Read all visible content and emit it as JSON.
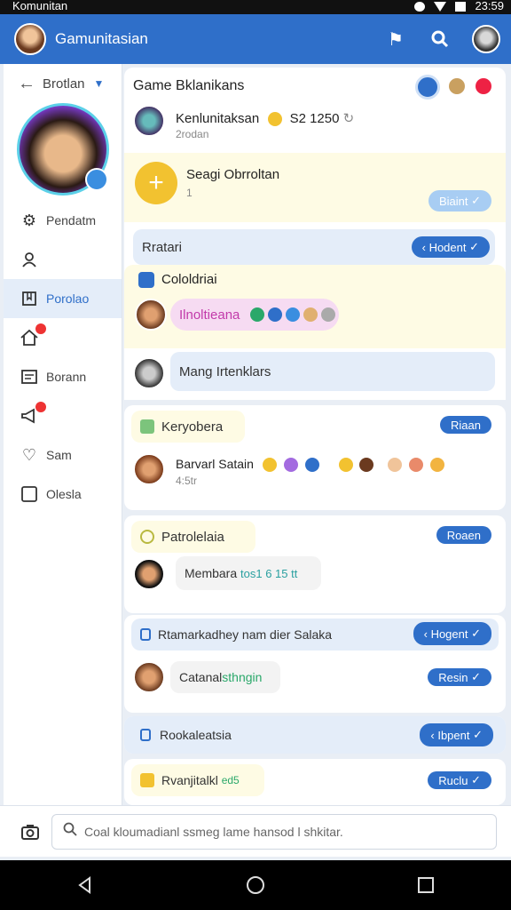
{
  "status": {
    "app_name": "Komunitan",
    "time": "23:59"
  },
  "appbar": {
    "title": "Gamunitasian"
  },
  "sidebar": {
    "back_label": "Brotlan",
    "items": [
      {
        "label": "Pendatm",
        "icon": "gear-icon"
      },
      {
        "label": "",
        "icon": "person-icon"
      },
      {
        "label": "Porolao",
        "icon": "bookmark-icon",
        "active": true
      },
      {
        "label": "",
        "icon": "home-icon",
        "badge": true
      },
      {
        "label": "Borann",
        "icon": "list-icon"
      },
      {
        "label": "",
        "icon": "megaphone-icon",
        "badge": true
      },
      {
        "label": "Sam",
        "icon": "heart-icon"
      },
      {
        "label": "Olesla",
        "icon": "square-icon"
      }
    ]
  },
  "main": {
    "header": {
      "title": "Game Bklanikans",
      "poster_name": "Kenlunitaksan",
      "poster_meta": "S2 1250",
      "poster_sub": "2rodan"
    },
    "add_section": {
      "title": "Seagi Obrroltan",
      "sub": "1",
      "button": "Biaint"
    },
    "row_rratari": {
      "label": "Rratari",
      "button": "Hodent"
    },
    "colold": {
      "title": "Cololdriai",
      "chip": "Ilnoltieana"
    },
    "mang": {
      "text": "Mang Irtenklars"
    },
    "keyo": {
      "tag": "Keryobera",
      "button": "Riaan",
      "name": "Barvarl Satain",
      "meta": "4:5tr"
    },
    "patro": {
      "tag": "Patrolelaia",
      "button": "Roaen",
      "bubble_name": "Membara",
      "bubble_hl": "tos1 6 15 tt"
    },
    "rtamark": {
      "label": "Rtamarkadhey nam dier Salaka",
      "button": "Hogent"
    },
    "catana": {
      "text": "Catanal",
      "hl": "sthngin",
      "button": "Resin"
    },
    "rookal": {
      "label": "Rookaleatsia",
      "button": "Ibpent"
    },
    "rvanj": {
      "label": "Rvanjitalkl",
      "hl": "ed5",
      "button": "Ruclu"
    }
  },
  "search": {
    "placeholder": "Coal kloumadianl ssmeg lame hansod l shkitar."
  },
  "colors": {
    "primary": "#2f6fc9",
    "accent_yellow": "#f2c230",
    "light_blue": "#a8cdf3"
  }
}
